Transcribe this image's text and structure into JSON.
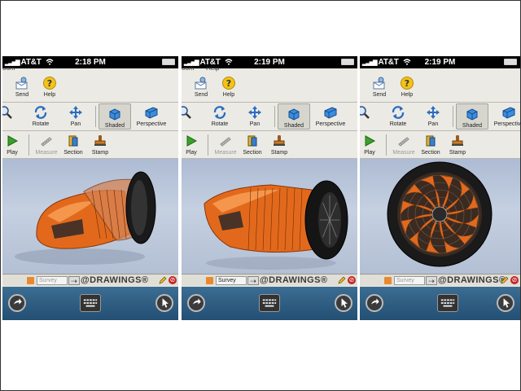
{
  "phones": [
    {
      "status": {
        "carrier": "AT&T",
        "time": "2:18 PM"
      },
      "cut_menu": [
        "oom",
        ""
      ],
      "toolbar": {
        "send": "Send",
        "help": "Help",
        "rotate": "Rotate",
        "pan": "Pan",
        "shaded": "Shaded",
        "perspective": "Perspective",
        "play": "Play",
        "measure": "Measure",
        "section": "Section",
        "stamp": "Stamp"
      },
      "bottom": {
        "survey": "Survey",
        "brand": "@DRAWINGS®"
      }
    },
    {
      "status": {
        "carrier": "AT&T",
        "time": "2:19 PM"
      },
      "cut_menu": [
        "oom",
        "Help"
      ],
      "toolbar": {
        "send": "Send",
        "help": "Help",
        "rotate": "Rotate",
        "pan": "Pan",
        "shaded": "Shaded",
        "perspective": "Perspective",
        "play": "Play",
        "measure": "Measure",
        "section": "Section",
        "stamp": "Stamp"
      },
      "bottom": {
        "survey": "Survey",
        "brand": "@DRAWINGS®"
      }
    },
    {
      "status": {
        "carrier": "AT&T",
        "time": "2:19 PM"
      },
      "cut_menu": [
        "",
        ""
      ],
      "toolbar": {
        "send": "Send",
        "help": "Help",
        "rotate": "Rotate",
        "pan": "Pan",
        "shaded": "Shaded",
        "perspective": "Perspective",
        "play": "Play",
        "measure": "Measure",
        "section": "Section",
        "stamp": "Stamp"
      },
      "bottom": {
        "survey": "Survey",
        "brand": "@DRAWINGS®"
      }
    }
  ],
  "colors": {
    "status_bar": "#000000",
    "toolbar_bg": "#ebeae4",
    "viewport_sky": "#b8c4d8",
    "model_orange": "#e0691c",
    "nav_bar": "#2d5c80"
  }
}
